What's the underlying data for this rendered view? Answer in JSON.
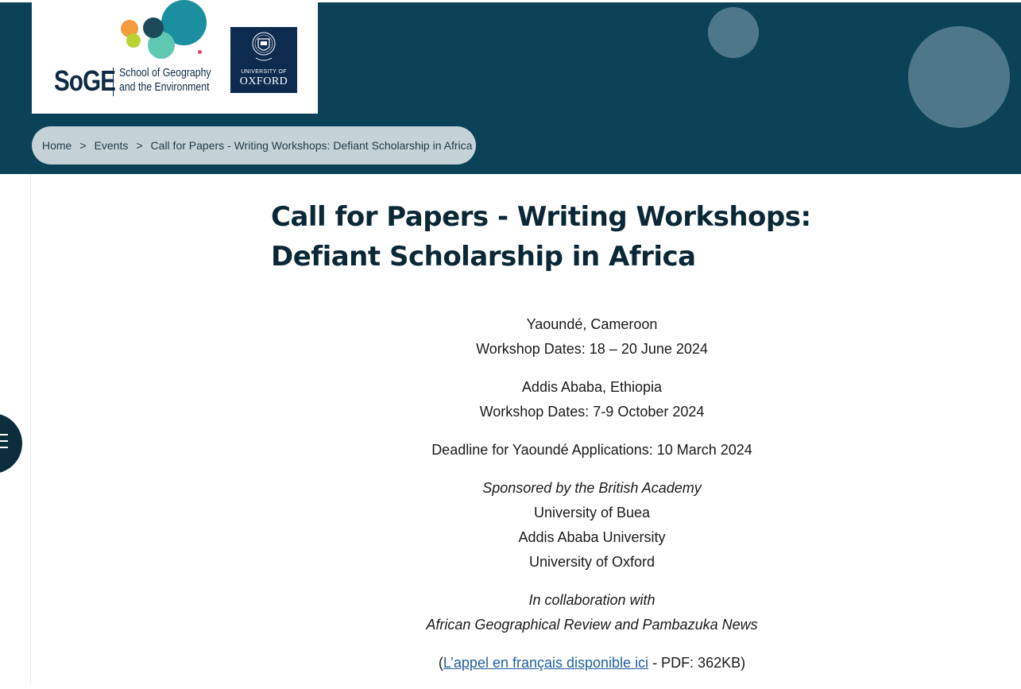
{
  "header": {
    "logo": {
      "short_name": "SoGE",
      "full_name_line1": "School of Geography",
      "full_name_line2": "and the Environment",
      "university_small": "UNIVERSITY OF",
      "university_big": "OXFORD"
    },
    "colors": {
      "banner": "#0b4257",
      "breadcrumb_bg": "#c5d3d9",
      "title": "#0b2836",
      "link": "#1f5f9e"
    }
  },
  "breadcrumb": {
    "items": [
      "Home",
      "Events",
      "Call for Papers - Writing Workshops: Defiant Scholarship in Africa"
    ],
    "separator": ">"
  },
  "side_menu": {
    "icon": "menu-icon"
  },
  "page": {
    "title": "Call for Papers - Writing Workshops: Defiant Scholarship in Africa",
    "location1": "Yaoundé, Cameroon",
    "dates1": "Workshop Dates: 18 – 20 June 2024",
    "location2": "Addis Ababa, Ethiopia",
    "dates2": "Workshop Dates: 7-9 October 2024",
    "deadline": "Deadline for Yaoundé Applications: 10 March 2024",
    "sponsor_intro": "Sponsored by the British Academy",
    "partners": [
      "University of Buea",
      "Addis Ababa University",
      "University of Oxford"
    ],
    "collab_intro": "In collaboration with",
    "collab_partners": "African Geographical Review and Pambazuka News",
    "french_open": "(",
    "french_link": "L’appel en français disponible ici",
    "french_tail": " - PDF: 362KB)"
  }
}
